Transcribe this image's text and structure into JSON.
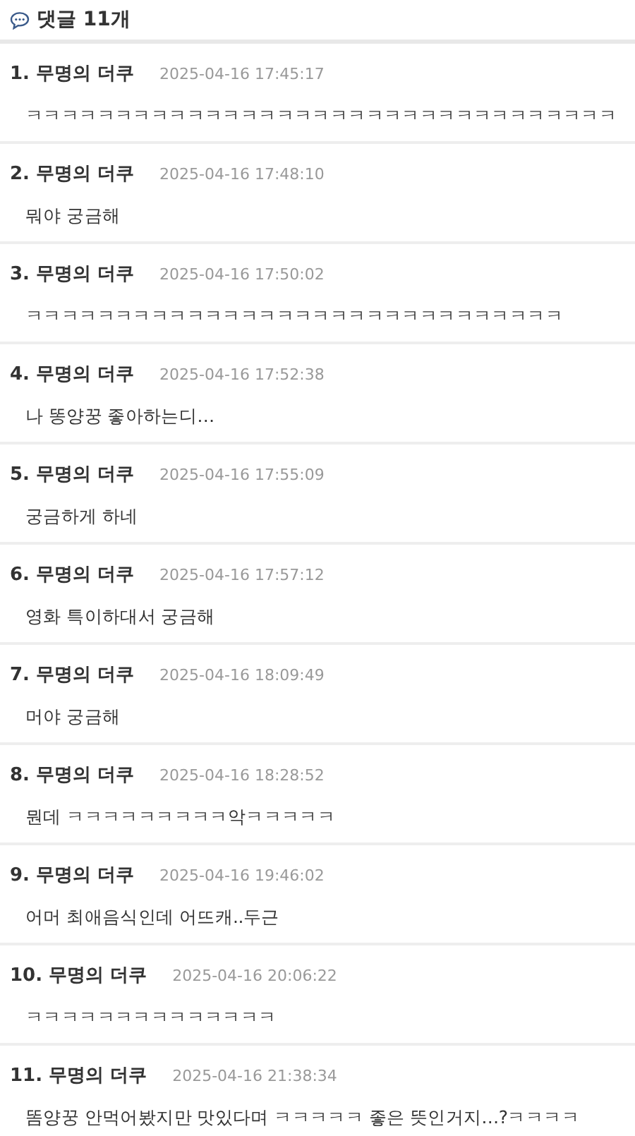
{
  "header": {
    "title": "댓글 11개"
  },
  "comments": [
    {
      "number": "1.",
      "author": "무명의 더쿠",
      "time": "2025-04-16 17:45:17",
      "text": "ㅋㅋㅋㅋㅋㅋㅋㅋㅋㅋㅋㅋㅋㅋㅋㅋㅋㅋㅋㅋㅋㅋㅋㅋㅋㅋㅋㅋㅋㅋㅋㅋㅋ"
    },
    {
      "number": "2.",
      "author": "무명의 더쿠",
      "time": "2025-04-16 17:48:10",
      "text": "뭐야 궁금해"
    },
    {
      "number": "3.",
      "author": "무명의 더쿠",
      "time": "2025-04-16 17:50:02",
      "text": "ㅋㅋㅋㅋㅋㅋㅋㅋㅋㅋㅋㅋㅋㅋㅋㅋㅋㅋㅋㅋㅋㅋㅋㅋㅋㅋㅋㅋㅋㅋ"
    },
    {
      "number": "4.",
      "author": "무명의 더쿠",
      "time": "2025-04-16 17:52:38",
      "text": "나 똥양꿍 좋아하는디…"
    },
    {
      "number": "5.",
      "author": "무명의 더쿠",
      "time": "2025-04-16 17:55:09",
      "text": "궁금하게 하네"
    },
    {
      "number": "6.",
      "author": "무명의 더쿠",
      "time": "2025-04-16 17:57:12",
      "text": "영화 특이하대서 궁금해"
    },
    {
      "number": "7.",
      "author": "무명의 더쿠",
      "time": "2025-04-16 18:09:49",
      "text": "머야 궁금해"
    },
    {
      "number": "8.",
      "author": "무명의 더쿠",
      "time": "2025-04-16 18:28:52",
      "text": "뭔데 ㅋㅋㅋㅋㅋㅋㅋㅋㅋ악ㅋㅋㅋㅋㅋ"
    },
    {
      "number": "9.",
      "author": "무명의 더쿠",
      "time": "2025-04-16 19:46:02",
      "text": "어머 최애음식인데 어뜨캐..두근"
    },
    {
      "number": "10.",
      "author": "무명의 더쿠",
      "time": "2025-04-16 20:06:22",
      "text": "ㅋㅋㅋㅋㅋㅋㅋㅋㅋㅋㅋㅋㅋㅋ"
    },
    {
      "number": "11.",
      "author": "무명의 더쿠",
      "time": "2025-04-16 21:38:34",
      "text": "똠양꿍 안먹어봤지만 맛있다며 ㅋㅋㅋㅋㅋ 좋은 뜻인거지…?ㅋㅋㅋㅋ"
    }
  ]
}
